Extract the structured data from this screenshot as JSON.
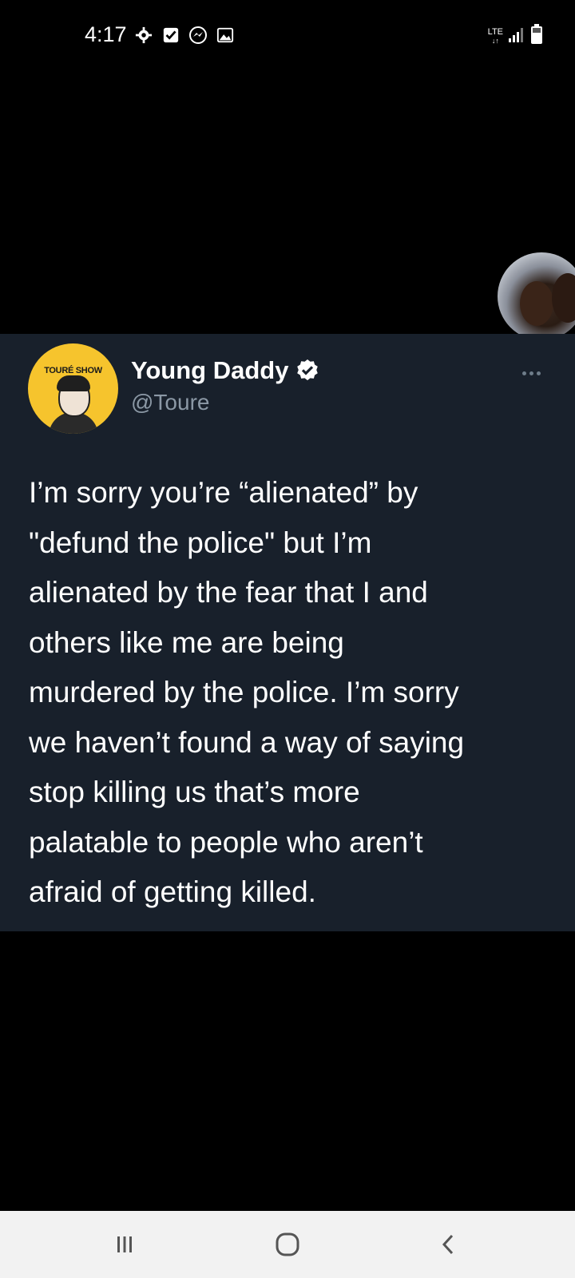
{
  "status_bar": {
    "time": "4:17",
    "network": "LTE",
    "icons": [
      "settings-icon",
      "checkbox-icon",
      "messenger-icon",
      "gallery-icon",
      "signal-icon",
      "battery-icon"
    ]
  },
  "tweet": {
    "avatar_label": "TOURÉ SHOW",
    "display_name": "Young Daddy",
    "handle": "@Toure",
    "text": "I’m sorry you’re “alienated” by\n\"defund the police\" but I’m\nalienated by the fear that I and\nothers like me are being\nmurdered by the police. I’m sorry\nwe haven’t found a way of saying\nstop killing us that’s more\npalatable to people who aren’t\nafraid of getting killed.",
    "verified": true
  },
  "colors": {
    "background": "#000000",
    "card": "#18202b",
    "handle": "#8b98a5",
    "avatar_bg": "#f6c42d",
    "verified_fill": "#ffffff",
    "nav_bar": "#f2f2f2"
  },
  "nav_bar": {
    "recents": "recents-icon",
    "home": "home-icon",
    "back": "back-icon"
  }
}
